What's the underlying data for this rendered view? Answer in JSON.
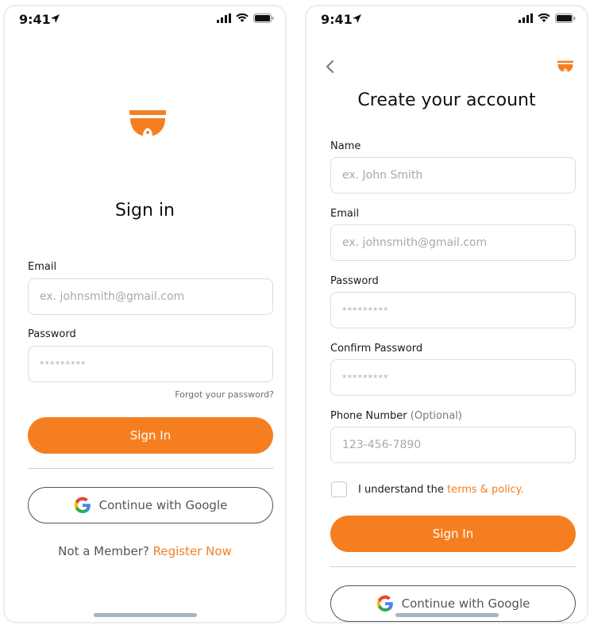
{
  "status": {
    "time": "9:41"
  },
  "signin": {
    "title": "Sign in",
    "email_label": "Email",
    "email_placeholder": "ex. johnsmith@gmail.com",
    "password_label": "Password",
    "password_placeholder": "*********",
    "forgot_label": "Forgot your password?",
    "sign_in_button": "Sign In",
    "google_button": "Continue with Google",
    "not_member_text": "Not a Member?",
    "register_link": "Register Now"
  },
  "register": {
    "title": "Create your account",
    "name_label": "Name",
    "name_placeholder": "ex. John Smith",
    "email_label": "Email",
    "email_placeholder": "ex. johnsmith@gmail.com",
    "password_label": "Password",
    "password_placeholder": "*********",
    "confirm_label": "Confirm Password",
    "confirm_placeholder": "*********",
    "phone_label": "Phone Number",
    "phone_optional": "(Optional)",
    "phone_placeholder": "123-456-7890",
    "terms_text": "I understand the",
    "terms_link": "terms & policy.",
    "sign_in_button": "Sign In",
    "google_button": "Continue with Google"
  },
  "colors": {
    "accent": "#f57f20",
    "border": "#dcdcdc",
    "text": "#1a1a1a",
    "muted": "#a9a9a9"
  }
}
